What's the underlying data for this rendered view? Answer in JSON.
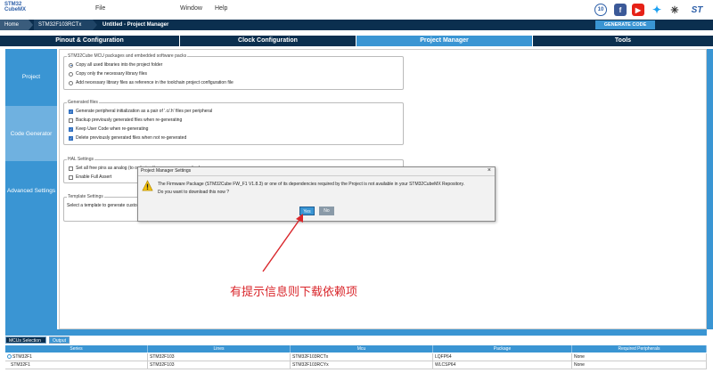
{
  "app": {
    "logo_line1": "STM32",
    "logo_line2": "CubeMX",
    "menu": [
      "File",
      "Window",
      "Help"
    ],
    "social_icons": [
      "anniversary-badge-icon",
      "facebook-icon",
      "youtube-icon",
      "twitter-icon",
      "network-icon",
      "st-logo-icon"
    ],
    "badge_text": "10"
  },
  "breadcrumb": [
    "Home",
    "STM32F103RCTx",
    "Untitled - Project Manager"
  ],
  "generate_button": "GENERATE CODE",
  "tabs": [
    "Pinout & Configuration",
    "Clock Configuration",
    "Project Manager",
    "Tools"
  ],
  "sidebar": [
    "Project",
    "Code Generator",
    "Advanced Settings"
  ],
  "packages": {
    "title": "STM32Cube MCU packages and embedded software packs",
    "options": [
      "Copy all used libraries into the project folder",
      "Copy only the necessary library files",
      "Add necessary library files as reference in the toolchain project configuration file"
    ]
  },
  "generated_files": {
    "title": "Generated files",
    "options": [
      "Generate peripheral initialization as a pair of '.c/.h' files per peripheral",
      "Backup previously generated files when re-generating",
      "Keep User Code when re-generating",
      "Delete previously generated files when not re-generated"
    ],
    "checked": [
      true,
      false,
      true,
      true
    ]
  },
  "hal": {
    "title": "HAL Settings",
    "options": [
      "Set all free pins as analog (to optimize the power consumption)",
      "Enable Full Assert"
    ]
  },
  "template": {
    "title": "Template Settings",
    "text": "Select a template to generate customized code"
  },
  "dialog": {
    "title": "Project Manager Settings",
    "close": "×",
    "line1": "The Firmware Package (STM32Cube FW_F1 V1.8.3) or one of its dependencies required by the Project is not available in your STM32CubeMX Repository.",
    "line2": "Do you want to download this now ?",
    "yes": "Yes",
    "no": "No"
  },
  "annotation": "有提示信息则下载依赖项",
  "bottom_tabs": [
    "MCUs Selection",
    "Output"
  ],
  "table": {
    "headers": [
      "Series",
      "Lines",
      "Mcu",
      "Package",
      "Required Peripherals"
    ],
    "rows": [
      [
        "STM32F1",
        "STM32F103",
        "STM32F103RCTx",
        "LQFP64",
        "None"
      ],
      [
        "STM32F1",
        "STM32F103",
        "STM32F103RCYx",
        "WLCSP64",
        "None"
      ]
    ]
  },
  "colors": {
    "accent": "#3a95d3",
    "dark": "#0b2f4f",
    "annotation": "#d9262b"
  }
}
